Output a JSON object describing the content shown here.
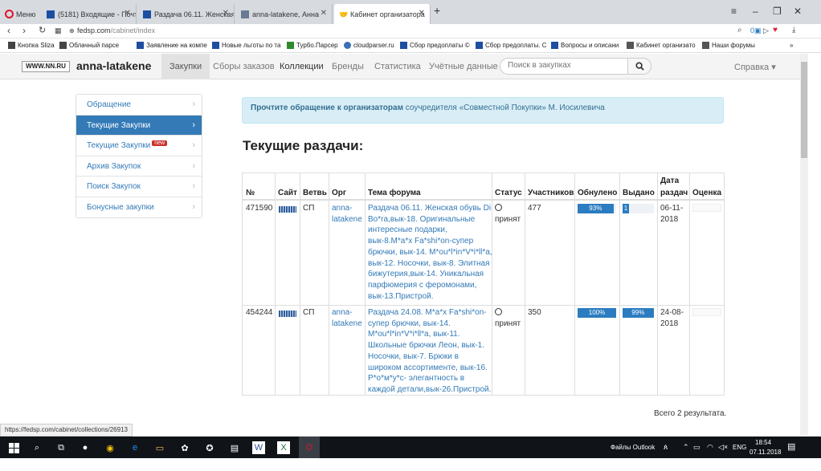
{
  "browser": {
    "tabs": [
      {
        "label": "Меню"
      },
      {
        "label": "(5181) Входящие - Почта"
      },
      {
        "label": "Раздача 06.11. Женская о"
      },
      {
        "label": "anna-latakene, Анна"
      },
      {
        "label": "Кабинет организатора"
      }
    ],
    "url_domain": "fedsp.com",
    "url_path": "/cabinet/index",
    "bookmarks": [
      "Кнопка Sliza",
      "Облачный парсе",
      "Заявление на компе",
      "Новые льготы по та",
      "Турбо.Парсер",
      "cloudparser.ru",
      "Сбор предоплаты ©",
      "Сбор предоплаты. С",
      "Вопросы и описани",
      "Кабинет организато",
      "Наши форумы"
    ]
  },
  "header": {
    "logo_text": "WWW.NN.RU",
    "username": "anna-latakene",
    "nav": [
      "Закупки",
      "Сборы заказов",
      "Коллекции",
      "Бренды",
      "Статистика",
      "Учётные данные"
    ],
    "search_placeholder": "Поиск в закупках",
    "help": "Справка ▾"
  },
  "sidebar": {
    "items": [
      {
        "label": "Обращение"
      },
      {
        "label": "Текущие Закупки"
      },
      {
        "label": "Текущие Закупки",
        "badge": "new"
      },
      {
        "label": "Архив Закупок"
      },
      {
        "label": "Поиск Закупок"
      },
      {
        "label": "Бонусные закупки"
      }
    ]
  },
  "alert": {
    "strong": "Прочтите обращение к организаторам",
    "rest": " соучредителя «Совместной Покупки» М. Иосилевича"
  },
  "heading": "Текущие раздачи:",
  "table": {
    "headers": [
      "№",
      "Сайт",
      "Ветвь",
      "Орг",
      "Тема форума",
      "Статус",
      "Участников",
      "Обнулено",
      "Выдано",
      "Дата",
      "раздач",
      "Оценка"
    ],
    "rows": [
      {
        "num": "471590",
        "branch": "СП",
        "org1": "anna-",
        "org2": "latakene",
        "topic": [
          "Раздача 06.11. Женская обувь Di",
          "Bo*ra,вык-18. Оригинальные",
          "интересные подарки,",
          "вык-8.M*a*x Fa*shi*on-супер",
          "брючки, вык-14. M*ou*l*in*V*i*ll*a,",
          "вык-12. Носочки, вык-8. Элитная",
          "бижутерия,вык-14. Уникальная",
          "парфюмерия с феромонами,",
          "вык-13.Пристрой."
        ],
        "status": "принят",
        "participants": "477",
        "zeroed_label": "93%",
        "zeroed": 93,
        "issued_label": "1",
        "issued": 1,
        "date": [
          "06-11-",
          "2018"
        ]
      },
      {
        "num": "454244",
        "branch": "СП",
        "org1": "anna-",
        "org2": "latakene",
        "topic": [
          "Раздача 24.08. M*a*x Fa*shi*on-",
          "супер брючки, вык-14.",
          "M*ou*l*in*V*i*ll*a, вык-11.",
          "Школьные брючки Леон, вык-1.",
          "Носочки, вык-7. Брюки в",
          "широком ассортименте, вык-16.",
          "Р*о*м*у*с- элегантность в",
          "каждой детали,вык-26.Пристрой."
        ],
        "status": "принят",
        "participants": "350",
        "zeroed_label": "100%",
        "zeroed": 100,
        "issued_label": "99%",
        "issued": 99,
        "date": [
          "24-08-",
          "2018"
        ]
      }
    ]
  },
  "total": "Всего 2 результата.",
  "status_url": "https://fedsp.com/cabinet/collections/26913",
  "taskbar": {
    "outlook": "Файлы Outlook",
    "lang": "ENG",
    "time": "18:54",
    "date": "07.11.2018"
  },
  "colors": {
    "accent": "#337ab7",
    "alert_bg": "#d9edf7",
    "progress": "#2b7cc0"
  }
}
